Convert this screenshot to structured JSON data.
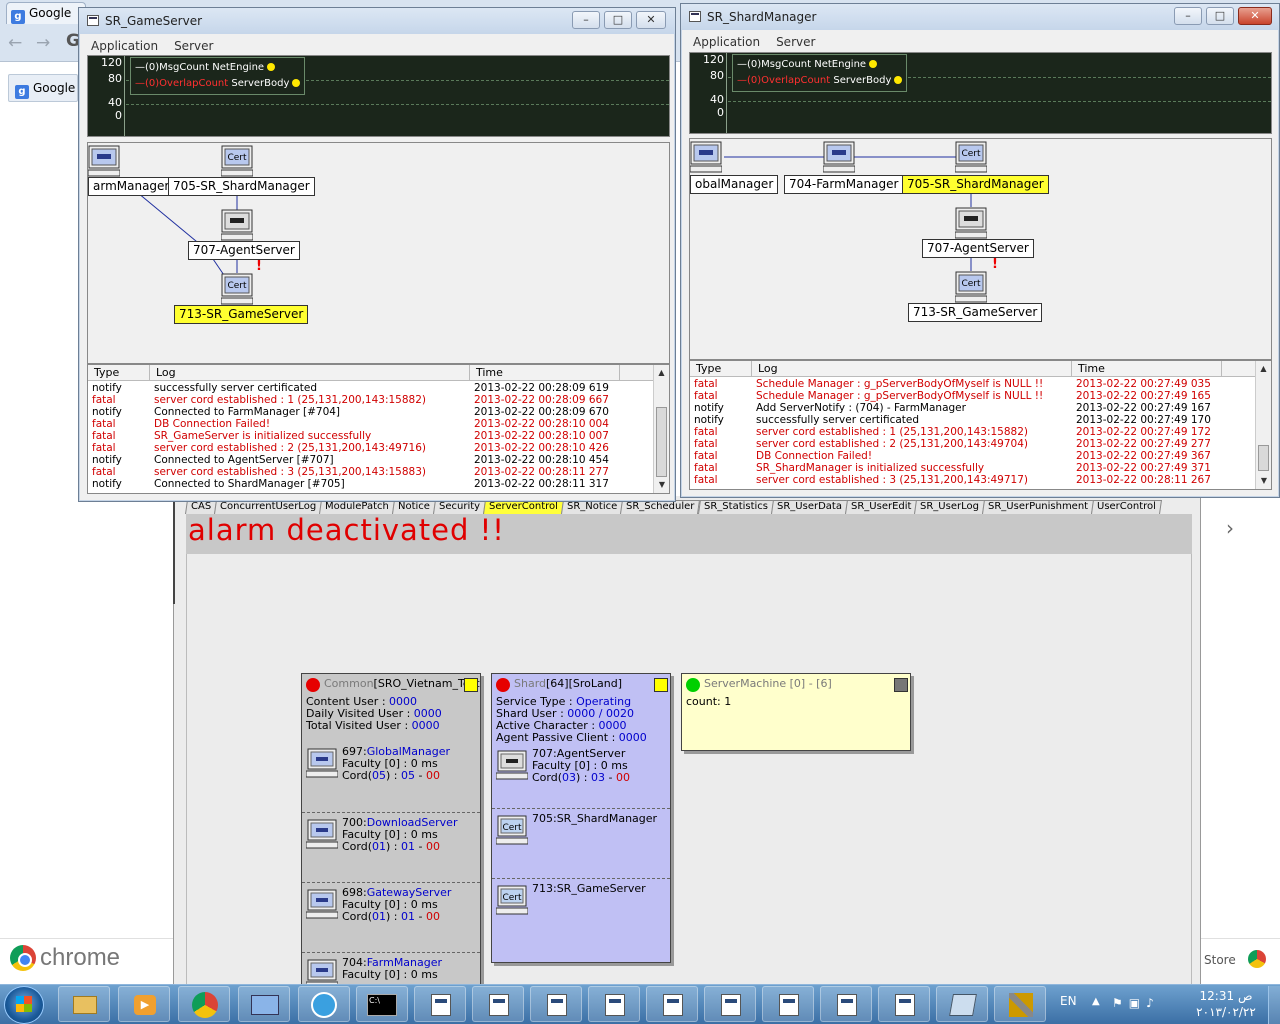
{
  "browser": {
    "tab_title": "Google",
    "ntp_tab": "Google",
    "brand": "chrome",
    "store": "Store"
  },
  "server_control": {
    "tabs": [
      "CAS",
      "ConcurrentUserLog",
      "ModulePatch",
      "Notice",
      "Security",
      "ServerControl",
      "SR_Notice",
      "SR_Scheduler",
      "SR_Statistics",
      "SR_UserData",
      "SR_UserEdit",
      "SR_UserLog",
      "SR_UserPunishment",
      "UserControl"
    ],
    "active_tab": "ServerControl",
    "alarm": "alarm deactivated !!",
    "common": {
      "prefix": "Common",
      "name": "[SRO_Vietnam_TestL",
      "content_user_label": "Content User : ",
      "content_user": "0000",
      "daily_label": "Daily Visited User : ",
      "daily": "0000",
      "total_label": "Total Visited User : ",
      "total": "0000",
      "nodes": [
        {
          "id": "697",
          "name": "GlobalManager",
          "faculty": "Faculty [0] : 0 ms",
          "cord_a": "05",
          "cord_b": "05",
          "cord_c": "00"
        },
        {
          "id": "700",
          "name": "DownloadServer",
          "faculty": "Faculty [0] : 0 ms",
          "cord_a": "01",
          "cord_b": "01",
          "cord_c": "00"
        },
        {
          "id": "698",
          "name": "GatewayServer",
          "faculty": "Faculty [0] : 0 ms",
          "cord_a": "01",
          "cord_b": "01",
          "cord_c": "00"
        },
        {
          "id": "704",
          "name": "FarmManager",
          "faculty": "Faculty [0] : 0 ms",
          "cord_a": "",
          "cord_b": "",
          "cord_c": ""
        }
      ]
    },
    "shard": {
      "prefix": "Shard",
      "name": "[64][SroLand]",
      "service_label": "Service Type : ",
      "service": "Operating",
      "shard_user_label": "Shard User : ",
      "shard_user": "0000 / 0020",
      "active_label": "Active Character : ",
      "active": "0000",
      "agent_label": "Agent Passive Client : ",
      "agent": "0000",
      "node1": {
        "id": "707",
        "name": "AgentServer",
        "faculty": "Faculty [0] : 0 ms",
        "cord_a": "03",
        "cord_b": "03",
        "cord_c": "00"
      },
      "node2": "705:SR_ShardManager",
      "node3": "713:SR_GameServer"
    },
    "machine": {
      "title": "ServerMachine [0] - [6]",
      "count": "count: 1"
    }
  },
  "game_window": {
    "title": "SR_GameServer",
    "menu": [
      "Application",
      "Server"
    ],
    "graph_y": [
      "120",
      "80",
      "40",
      "0"
    ],
    "legend1_count": "(0)MsgCount",
    "legend1_name": "NetEngine",
    "legend2_count": "(0)OverlapCount",
    "legend2_name": "ServerBody",
    "topology": {
      "farm": "armManager",
      "shard": "705-SR_ShardManager",
      "agent": "707-AgentServer",
      "game": "713-SR_GameServer",
      "cert": "Cert"
    },
    "log_headers": [
      "Type",
      "Log",
      "Time"
    ],
    "logs": [
      {
        "type": "notify",
        "msg": "successfully server certificated",
        "time": "2013-02-22 00:28:09 619"
      },
      {
        "type": "fatal",
        "msg": "server cord established : 1 (25,131,200,143:15882)",
        "time": "2013-02-22 00:28:09 667"
      },
      {
        "type": "notify",
        "msg": "Connected to FarmManager [#704]",
        "time": "2013-02-22 00:28:09 670"
      },
      {
        "type": "fatal",
        "msg": "DB Connection Failed!",
        "time": "2013-02-22 00:28:10 004"
      },
      {
        "type": "fatal",
        "msg": "SR_GameServer is initialized successfully",
        "time": "2013-02-22 00:28:10 007"
      },
      {
        "type": "fatal",
        "msg": "server cord established : 2 (25,131,200,143:49716)",
        "time": "2013-02-22 00:28:10 426"
      },
      {
        "type": "notify",
        "msg": "Connected to AgentServer [#707]",
        "time": "2013-02-22 00:28:10 454"
      },
      {
        "type": "fatal",
        "msg": "server cord established : 3 (25,131,200,143:15883)",
        "time": "2013-02-22 00:28:11 277"
      },
      {
        "type": "notify",
        "msg": "Connected to ShardManager [#705]",
        "time": "2013-02-22 00:28:11 317"
      }
    ]
  },
  "shard_window": {
    "title": "SR_ShardManager",
    "menu": [
      "Application",
      "Server"
    ],
    "graph_y": [
      "120",
      "80",
      "40",
      "0"
    ],
    "legend1_count": "(0)MsgCount",
    "legend1_name": "NetEngine",
    "legend2_count": "(0)OverlapCount",
    "legend2_name": "ServerBody",
    "topology": {
      "global": "obalManager",
      "farm": "704-FarmManager",
      "shard": "705-SR_ShardManager",
      "agent": "707-AgentServer",
      "game": "713-SR_GameServer",
      "cert": "Cert"
    },
    "log_headers": [
      "Type",
      "Log",
      "Time"
    ],
    "logs": [
      {
        "type": "fatal",
        "msg": "Schedule Manager : g_pServerBodyOfMyself is NULL !!",
        "time": "2013-02-22 00:27:49 035"
      },
      {
        "type": "fatal",
        "msg": "Schedule Manager : g_pServerBodyOfMyself is NULL !!",
        "time": "2013-02-22 00:27:49 165"
      },
      {
        "type": "notify",
        "msg": "Add ServerNotify : (704) - FarmManager",
        "time": "2013-02-22 00:27:49 167"
      },
      {
        "type": "notify",
        "msg": "successfully server certificated",
        "time": "2013-02-22 00:27:49 170"
      },
      {
        "type": "fatal",
        "msg": "server cord established : 1 (25,131,200,143:15882)",
        "time": "2013-02-22 00:27:49 172"
      },
      {
        "type": "fatal",
        "msg": "server cord established : 2 (25,131,200,143:49704)",
        "time": "2013-02-22 00:27:49 277"
      },
      {
        "type": "fatal",
        "msg": "DB Connection Failed!",
        "time": "2013-02-22 00:27:49 367"
      },
      {
        "type": "fatal",
        "msg": "SR_ShardManager is initialized successfully",
        "time": "2013-02-22 00:27:49 371"
      },
      {
        "type": "fatal",
        "msg": "server cord established : 3 (25,131,200,143:49717)",
        "time": "2013-02-22 00:28:11 267"
      }
    ]
  },
  "taskbar": {
    "lang": "EN",
    "time": "12:31 ص",
    "date": "٢٠١٣/٠٢/٢٢",
    "cmd_label": "C:\\"
  }
}
